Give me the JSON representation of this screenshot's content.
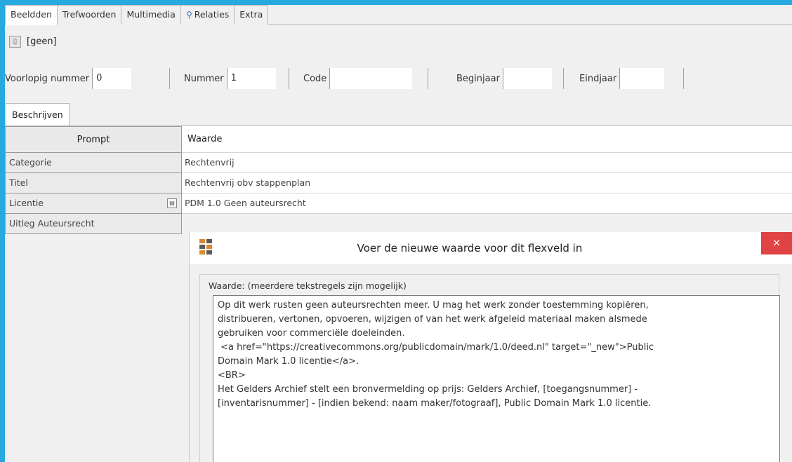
{
  "tabs": [
    {
      "label": "Beeldden",
      "active": true
    },
    {
      "label": "Trefwoorden",
      "active": false
    },
    {
      "label": "Multimedia",
      "active": false
    },
    {
      "label": "Relaties",
      "active": false,
      "icon": "link-icon"
    },
    {
      "label": "Extra",
      "active": false
    }
  ],
  "toolrow": {
    "status": "[geen]"
  },
  "fields": {
    "voorlopig_label": "Voorlopig nummer",
    "voorlopig_value": "0",
    "nummer_label": "Nummer",
    "nummer_value": "1",
    "code_label": "Code",
    "code_value": "",
    "beginjaar_label": "Beginjaar",
    "beginjaar_value": "",
    "eindjaar_label": "Eindjaar",
    "eindjaar_value": ""
  },
  "sub_tab": "Beschrijven",
  "grid": {
    "prompt_header": "Prompt",
    "value_header": "Waarde",
    "rows": [
      {
        "prompt": "Categorie",
        "value": "Rechtenvrij"
      },
      {
        "prompt": "Titel",
        "value": "Rechtenvrij obv stappenplan"
      },
      {
        "prompt": "Licentie",
        "value": "PDM 1.0 Geen auteursrecht"
      },
      {
        "prompt": "Uitleg Auteursrecht",
        "value": ""
      }
    ]
  },
  "dialog": {
    "title": "Voer de nieuwe waarde voor dit flexveld in",
    "close": "×",
    "group_label": "Waarde: (meerdere tekstregels zijn mogelijk)",
    "text": "Op dit werk rusten geen auteursrechten meer. U mag het werk zonder toestemming kopiëren,\ndistribueren, vertonen, opvoeren, wijzigen of van het werk afgeleid materiaal maken alsmede\ngebruiken voor commerciële doeleinden.\n <a href=\"https://creativecommons.org/publicdomain/mark/1.0/deed.nl\" target=\"_new\">Public\nDomain Mark 1.0 licentie</a>.\n<BR>\nHet Gelders Archief stelt een bronvermelding op prijs: Gelders Archief, [toegangsnummer] -\n[inventarisnummer] - [indien bekend: naam maker/fotograaf], Public Domain Mark 1.0 licentie."
  },
  "colors": {
    "frame": "#28a8e0",
    "close": "#e04343"
  }
}
